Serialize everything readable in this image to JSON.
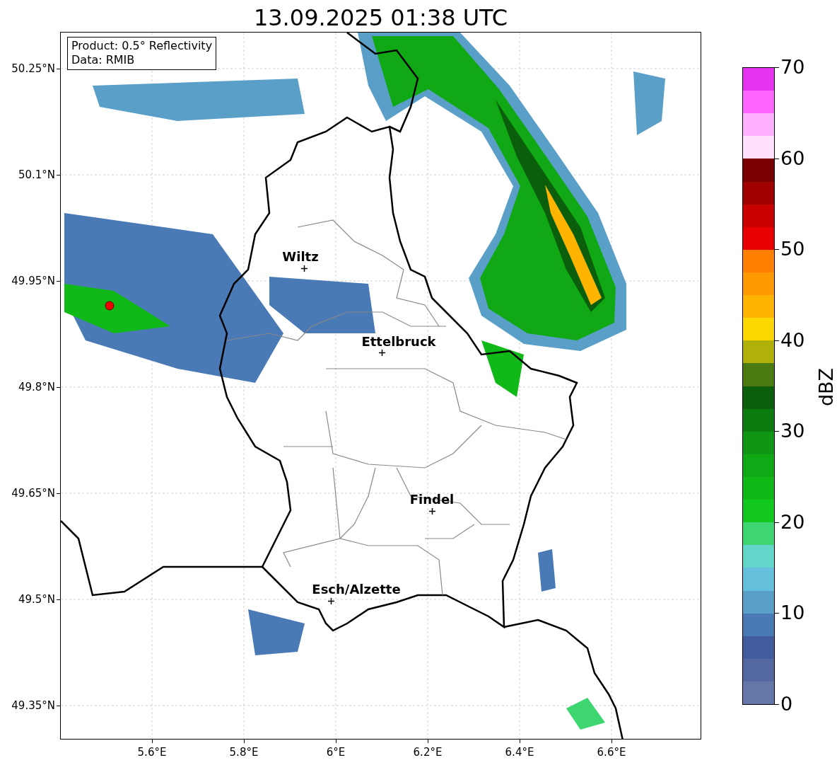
{
  "title": "13.09.2025 01:38 UTC",
  "info_box": [
    "Product: 0.5° Reflectivity",
    "Data: RMIB"
  ],
  "lat_ticks": [
    "50.25°N",
    "50.1°N",
    "49.95°N",
    "49.8°N",
    "49.65°N",
    "49.5°N",
    "49.35°N"
  ],
  "lon_ticks": [
    "5.6°E",
    "5.8°E",
    "6°E",
    "6.2°E",
    "6.4°E",
    "6.6°E"
  ],
  "cities": [
    {
      "name": "Wiltz"
    },
    {
      "name": "Ettelbruck"
    },
    {
      "name": "Findel"
    },
    {
      "name": "Esch/Alzette"
    }
  ],
  "colorbar": {
    "label": "dBZ",
    "ticks": [
      "70",
      "60",
      "50",
      "40",
      "30",
      "20",
      "10",
      "0"
    ],
    "bins": [
      {
        "color": "#e633f0"
      },
      {
        "color": "#ff66ff"
      },
      {
        "color": "#ffb0ff"
      },
      {
        "color": "#ffe0ff"
      },
      {
        "color": "#780000"
      },
      {
        "color": "#a00000"
      },
      {
        "color": "#c80000"
      },
      {
        "color": "#e80000"
      },
      {
        "color": "#ff7f00"
      },
      {
        "color": "#ff9a00"
      },
      {
        "color": "#ffb400"
      },
      {
        "color": "#ffd700"
      },
      {
        "color": "#b0b008"
      },
      {
        "color": "#4a7a10"
      },
      {
        "color": "#0a5e0c"
      },
      {
        "color": "#0c7c10"
      },
      {
        "color": "#0e9614"
      },
      {
        "color": "#10a814"
      },
      {
        "color": "#10b818"
      },
      {
        "color": "#12c81e"
      },
      {
        "color": "#3dd670"
      },
      {
        "color": "#62d6c8"
      },
      {
        "color": "#64c0dc"
      },
      {
        "color": "#5a9fc8"
      },
      {
        "color": "#4a7ab5"
      },
      {
        "color": "#435ca0"
      },
      {
        "color": "#5367a0"
      },
      {
        "color": "#6477a8"
      }
    ]
  }
}
